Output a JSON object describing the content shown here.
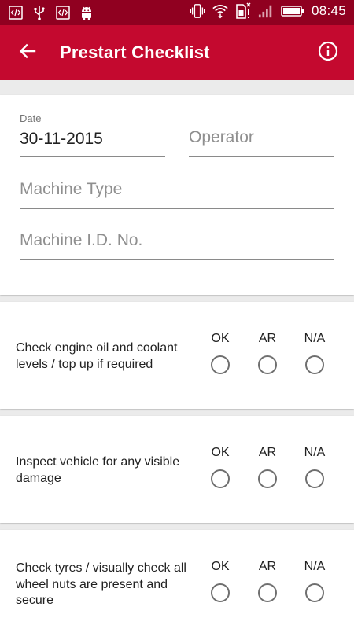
{
  "status_bar": {
    "time": "08:45",
    "left_icons": [
      "code-icon",
      "usb-icon",
      "code-icon",
      "android-icon"
    ],
    "right_icons": [
      "vibrate-icon",
      "wifi-icon",
      "sim-icon",
      "signal-icon",
      "battery-icon"
    ]
  },
  "app_bar": {
    "title": "Prestart Checklist",
    "back_icon": "arrow-back-icon",
    "info_icon": "info-icon",
    "color": "#c4092f"
  },
  "form": {
    "date_label": "Date",
    "date_value": "30-11-2015",
    "operator_placeholder": "Operator",
    "machine_type_placeholder": "Machine Type",
    "machine_id_placeholder": "Machine I.D. No."
  },
  "options": [
    "OK",
    "AR",
    "N/A"
  ],
  "checks": [
    {
      "text": "Check engine oil and coolant levels / top up if required"
    },
    {
      "text": "Inspect vehicle for any visible damage"
    },
    {
      "text": "Check tyres / visually check all wheel nuts are present and secure"
    }
  ]
}
